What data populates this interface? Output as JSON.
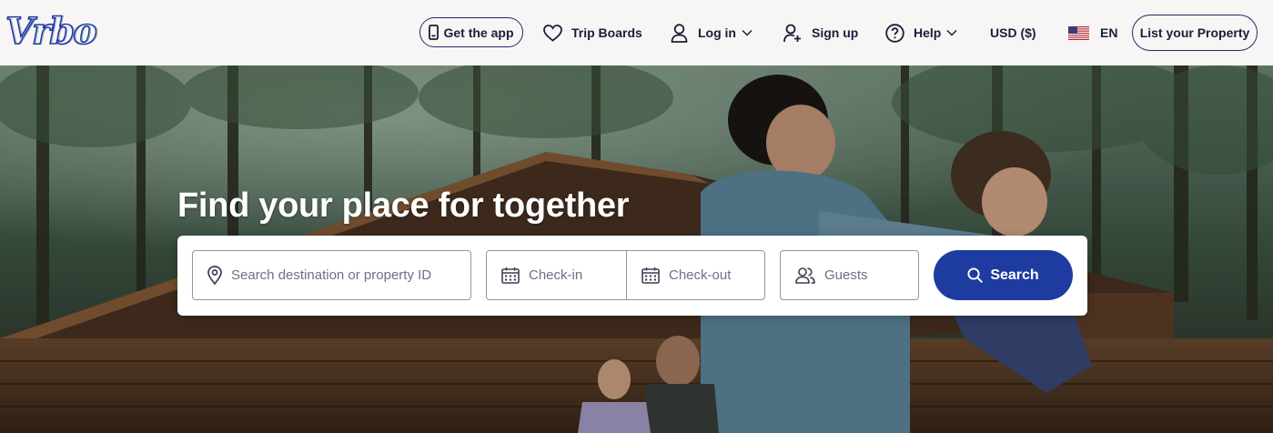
{
  "brand": {
    "logo_text": "Vrbo",
    "accent": "#1e3ca0",
    "ink": "#191e3b"
  },
  "header": {
    "get_app": "Get the app",
    "trip_boards": "Trip Boards",
    "log_in": "Log in",
    "sign_up": "Sign up",
    "help": "Help",
    "currency": "USD ($)",
    "language": "EN",
    "list_property": "List your Property"
  },
  "hero": {
    "headline": "Find your place for together"
  },
  "search": {
    "destination_placeholder": "Search destination or property ID",
    "checkin_placeholder": "Check-in",
    "checkout_placeholder": "Check-out",
    "guests_placeholder": "Guests",
    "button": "Search"
  }
}
